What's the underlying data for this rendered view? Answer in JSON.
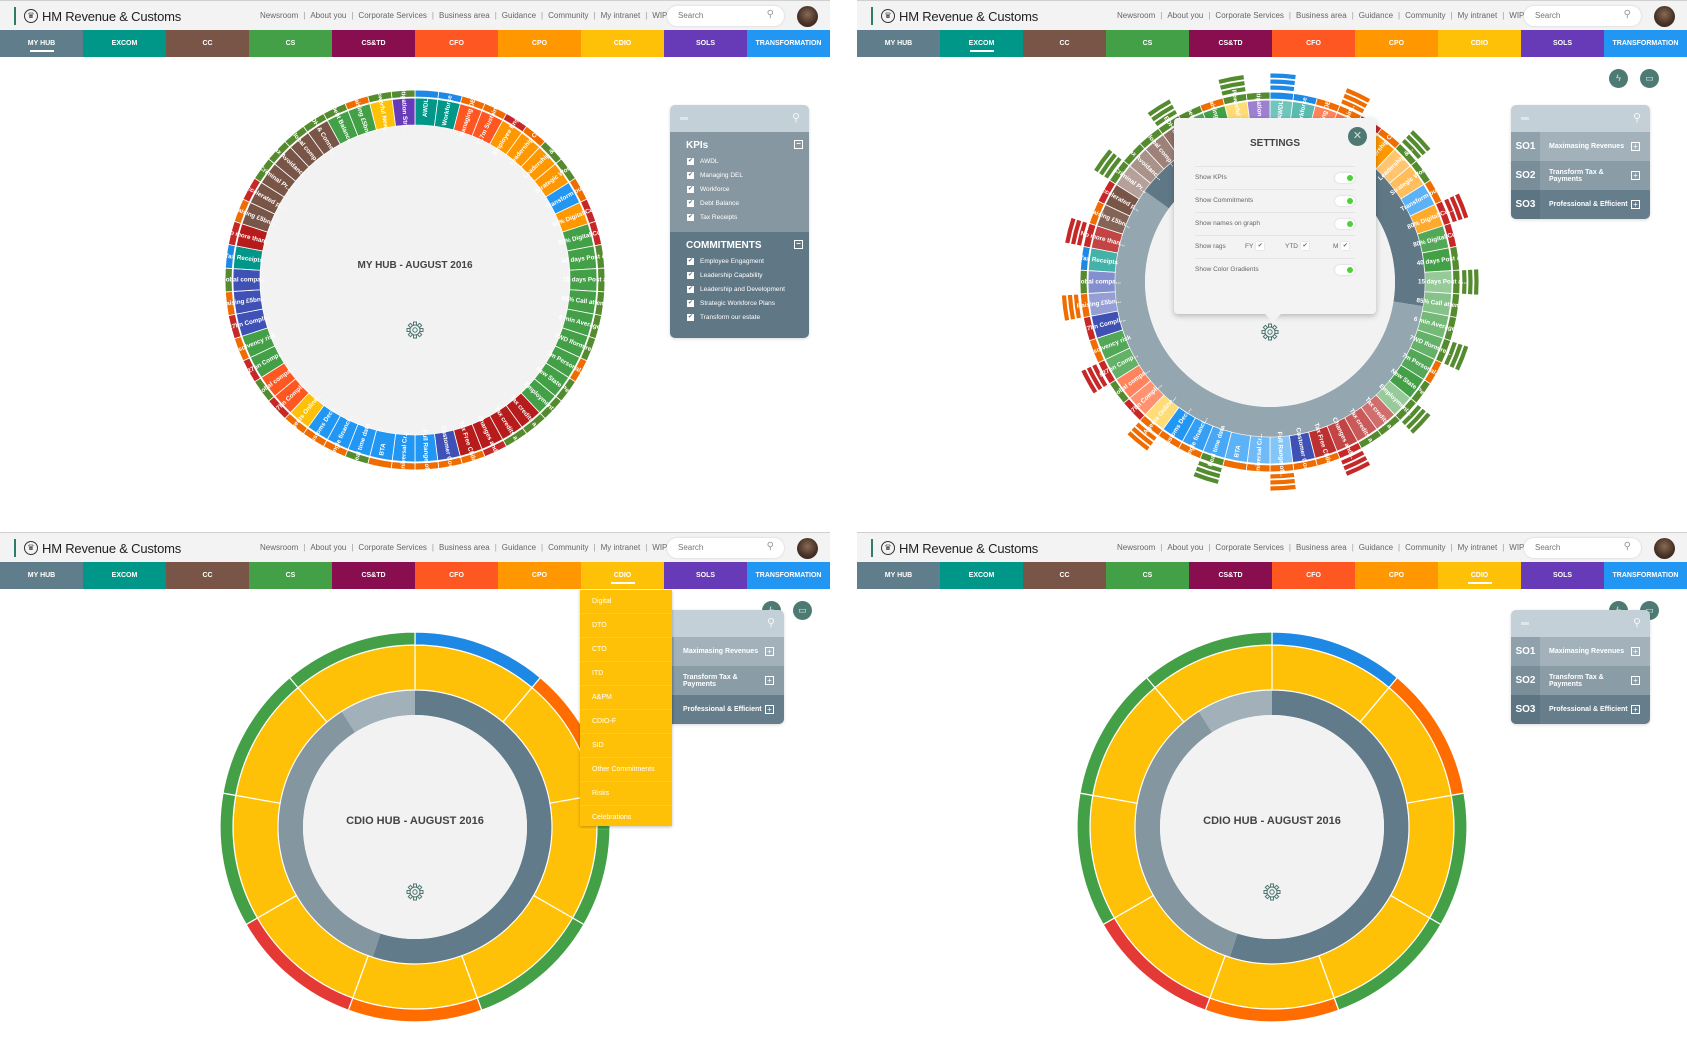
{
  "header": {
    "logo_text": "HM Revenue & Customs",
    "links": [
      "Newsroom",
      "About you",
      "Corporate Services",
      "Business area",
      "Guidance",
      "Community",
      "My intranet",
      "WIP"
    ],
    "search_placeholder": "Search"
  },
  "nav_tabs": [
    {
      "label": "MY HUB",
      "color": "#607d8b"
    },
    {
      "label": "EXCOM",
      "color": "#009688"
    },
    {
      "label": "CC",
      "color": "#795548"
    },
    {
      "label": "CS",
      "color": "#43a047"
    },
    {
      "label": "CS&TD",
      "color": "#880e4f"
    },
    {
      "label": "CFO",
      "color": "#ff5722"
    },
    {
      "label": "CPO",
      "color": "#ff9800"
    },
    {
      "label": "CDIO",
      "color": "#ffc107"
    },
    {
      "label": "SOLS",
      "color": "#673ab7"
    },
    {
      "label": "TRANSFORMATION",
      "color": "#2196f3"
    }
  ],
  "screens": [
    {
      "active_tab": "MY HUB",
      "hub_title": "MY HUB - AUGUST 2016"
    },
    {
      "active_tab": "EXCOM",
      "hub_title": ""
    },
    {
      "active_tab": "CDIO",
      "hub_title": "CDIO HUB - AUGUST 2016"
    },
    {
      "active_tab": "CDIO",
      "hub_title": "CDIO HUB - AUGUST 2016"
    }
  ],
  "kpi_panel": {
    "kpis_title": "KPIs",
    "kpis": [
      "AWDL",
      "Managing DEL",
      "Workforce",
      "Debt Balance",
      "Tax Receipts"
    ],
    "commitments_title": "COMMITMENTS",
    "commitments": [
      "Employee Engagment",
      "Leadership Capability",
      "Leadership and Development",
      "Strategic Workforce Plans",
      "Transform our estate"
    ]
  },
  "so_panel": {
    "rows": [
      {
        "code": "SO1",
        "label": "Maximasing Revenues"
      },
      {
        "code": "SO2",
        "label": "Transform Tax & Payments"
      },
      {
        "code": "SO3",
        "label": "Professional & Efficient"
      }
    ]
  },
  "settings": {
    "title": "SETTINGS",
    "show_kpis": "Show KPIs",
    "show_commitments": "Show Commitments",
    "show_names": "Show names on graph",
    "show_rags": "Show rags",
    "rag_fy": "FY",
    "rag_ytd": "YTD",
    "rag_m": "M",
    "show_gradients": "Show Color Gradients",
    "ring_label_so1": "SO1: Maximasing Revenues",
    "ring_label_so2": "SO2: Transform Tax and Payments"
  },
  "cdio_menu": [
    "Digital",
    "DTO",
    "CTO",
    "ITD",
    "A&PM",
    "CDIO-F",
    "SID",
    "Other Commitments",
    "Risks",
    "Celebrations"
  ],
  "chart_data": [
    {
      "type": "sunburst",
      "title": "MY HUB - AUGUST 2016",
      "segments": [
        {
          "label": "AWDL",
          "color": "#009688",
          "rag": "#1e88e5"
        },
        {
          "label": "Workforce",
          "color": "#009688",
          "rag": "#1e88e5"
        },
        {
          "label": "Managing DEL",
          "color": "#ff5722",
          "rag": "#ef6c00"
        },
        {
          "label": "717m Sustain...",
          "color": "#ff5722",
          "rag": "#ef6c00"
        },
        {
          "label": "Employee Eng...",
          "color": "#ff9800",
          "rag": "#c62828"
        },
        {
          "label": "Leadership C...",
          "color": "#ff9800",
          "rag": "#ef6c00"
        },
        {
          "label": "Leadership &...",
          "color": "#ff9800",
          "rag": "#558b2f"
        },
        {
          "label": "Strategic Wor...",
          "color": "#ff9800",
          "rag": "#558b2f"
        },
        {
          "label": "Transform ou...",
          "color": "#2196f3",
          "rag": "#ef6c00"
        },
        {
          "label": "80% Digital Cu...",
          "color": "#ff9800",
          "rag": "#c62828"
        },
        {
          "label": "80% Digital Cu...",
          "color": "#43a047",
          "rag": "#c62828"
        },
        {
          "label": "40 days Post a...",
          "color": "#43a047",
          "rag": "#558b2f"
        },
        {
          "label": "15 days Post a...",
          "color": "#43a047",
          "rag": "#558b2f"
        },
        {
          "label": "85% Call attem...",
          "color": "#43a047",
          "rag": "#558b2f"
        },
        {
          "label": "6 min Average...",
          "color": "#43a047",
          "rag": "#558b2f"
        },
        {
          "label": "7WD Iform re...",
          "color": "#43a047",
          "rag": "#558b2f"
        },
        {
          "label": "7m Personal...",
          "color": "#43a047",
          "rag": "#ef6c00"
        },
        {
          "label": "New State Pe...",
          "color": "#43a047",
          "rag": "#558b2f"
        },
        {
          "label": "Employment...",
          "color": "#43a047",
          "rag": "#558b2f"
        },
        {
          "label": "Tax credits a...",
          "color": "#b71c1c",
          "rag": "#558b2f"
        },
        {
          "label": "Tax credits a...",
          "color": "#b71c1c",
          "rag": "#558b2f"
        },
        {
          "label": "Changes and...",
          "color": "#b71c1c",
          "rag": "#c62828"
        },
        {
          "label": "Tax Free Child...",
          "color": "#b71c1c",
          "rag": "#ef6c00"
        },
        {
          "label": "Customer Cos...",
          "color": "#3f51b5",
          "rag": "#ef6c00"
        },
        {
          "label": "Full Range of...",
          "color": "#2196f3",
          "rag": "#ef6c00"
        },
        {
          "label": "Universal Cr...",
          "color": "#2196f3",
          "rag": "#ef6c00"
        },
        {
          "label": "BTA",
          "color": "#2196f3",
          "rag": "#ef6c00"
        },
        {
          "label": "Real time data",
          "color": "#2196f3",
          "rag": "#558b2f"
        },
        {
          "label": "Single financi...",
          "color": "#2196f3",
          "rag": "#ef6c00"
        },
        {
          "label": "Customs Decl...",
          "color": "#2196f3",
          "rag": "#ef6c00"
        },
        {
          "label": "Agents Online...",
          "color": "#ffc107",
          "rag": "#ef6c00"
        },
        {
          "label": "£27bn Compli...",
          "color": "#ff5722",
          "rag": "#c62828"
        },
        {
          "label": "Global compa...",
          "color": "#ff5722",
          "rag": "#558b2f"
        },
        {
          "label": "£27bn Comp...",
          "color": "#43a047",
          "rag": "#c62828"
        },
        {
          "label": "Insolvency risk",
          "color": "#43a047",
          "rag": "#ef6c00"
        },
        {
          "label": "£27bn Compli...",
          "color": "#3f51b5",
          "rag": "#c62828"
        },
        {
          "label": "Raising £5bn...",
          "color": "#3f51b5",
          "rag": "#ef6c00"
        },
        {
          "label": "Global compa...",
          "color": "#3f51b5",
          "rag": "#558b2f"
        },
        {
          "label": "Tax Receipts",
          "color": "#009688",
          "rag": "#1e88e5"
        },
        {
          "label": "No more than...",
          "color": "#b71c1c",
          "rag": "#c62828"
        },
        {
          "label": "Raising £5bn...",
          "color": "#795548",
          "rag": "#ef6c00"
        },
        {
          "label": "Accelerated p...",
          "color": "#795548",
          "rag": "#c62828"
        },
        {
          "label": "Criminal Pr...",
          "color": "#795548",
          "rag": "#558b2f"
        },
        {
          "label": "Tax Avoidanc...",
          "color": "#795548",
          "rag": "#558b2f"
        },
        {
          "label": "Global comp...",
          "color": "#795548",
          "rag": "#558b2f"
        },
        {
          "label": "EDH & Conne...",
          "color": "#795548",
          "rag": "#558b2f"
        },
        {
          "label": "Debt Balance",
          "color": "#43a047",
          "rag": "#558b2f"
        },
        {
          "label": "Raising £5bn...",
          "color": "#43a047",
          "rag": "#ef6c00"
        },
        {
          "label": "Powerful New...",
          "color": "#ffc107",
          "rag": "#558b2f"
        },
        {
          "label": "Litigation Str...",
          "color": "#673ab7",
          "rag": "#558b2f"
        }
      ]
    },
    {
      "type": "sunburst",
      "title": "CDIO HUB - AUGUST 2016",
      "inner_ring": [
        {
          "label": "SO1",
          "fraction": 0.09,
          "color": "#a2b1b9"
        },
        {
          "label": "SO2",
          "fraction": 0.63,
          "color": "#627b8b"
        },
        {
          "label": "SO3",
          "fraction": 0.28,
          "color": "#8496a0"
        }
      ],
      "segments": [
        {
          "label": "",
          "color": "#ffc107",
          "rag": "#1e88e5"
        },
        {
          "label": "",
          "color": "#ffc107",
          "rag": "#ff6d00"
        },
        {
          "label": "",
          "color": "#ffc107",
          "rag": "#43a047"
        },
        {
          "label": "",
          "color": "#ffc107",
          "rag": "#43a047"
        },
        {
          "label": "",
          "color": "#ffc107",
          "rag": "#ff6d00"
        },
        {
          "label": "",
          "color": "#ffc107",
          "rag": "#e53935"
        },
        {
          "label": "",
          "color": "#ffc107",
          "rag": "#43a047"
        },
        {
          "label": "",
          "color": "#ffc107",
          "rag": "#43a047"
        },
        {
          "label": "",
          "color": "#ffc107",
          "rag": "#43a047"
        }
      ]
    }
  ]
}
